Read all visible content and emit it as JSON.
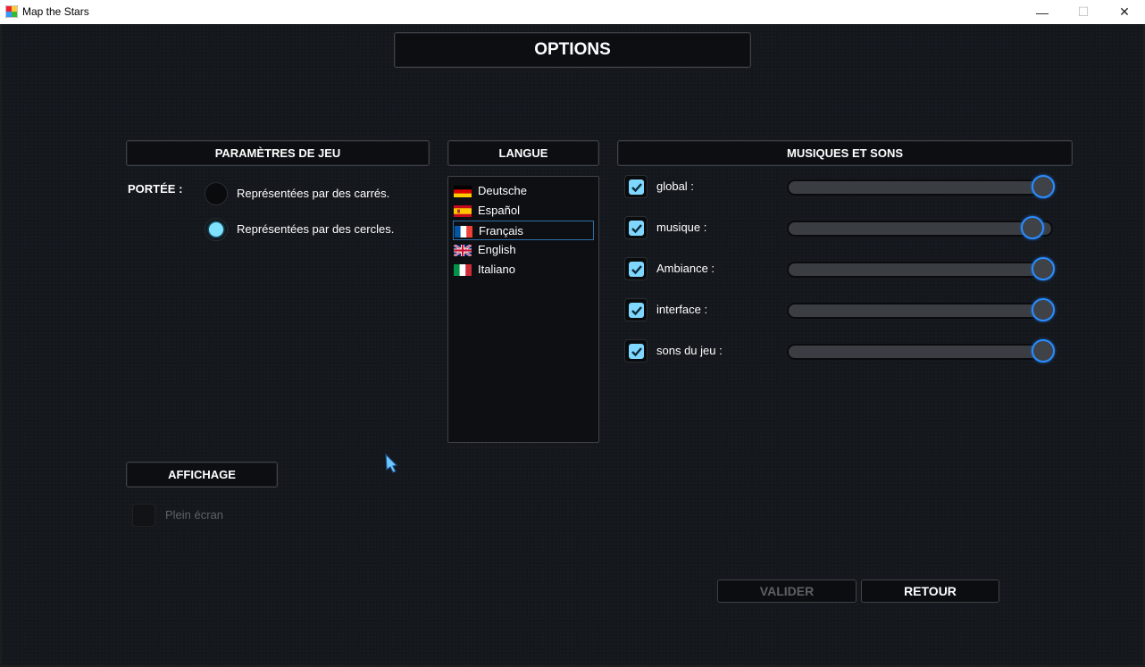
{
  "window": {
    "title": "Map the Stars",
    "minimize": "—",
    "maximize": "☐",
    "close": "✕"
  },
  "page": {
    "title": "OPTIONS"
  },
  "game_settings": {
    "header": "PARAMÈTRES DE JEU",
    "range_label": "PORTÉE :",
    "options": [
      {
        "label": "Représentées par des carrés.",
        "selected": false
      },
      {
        "label": "Représentées par des cercles.",
        "selected": true
      }
    ]
  },
  "language": {
    "header": "LANGUE",
    "items": [
      {
        "label": "Deutsche",
        "flag": "germany-flag-icon",
        "selected": false
      },
      {
        "label": "Español",
        "flag": "spain-flag-icon",
        "selected": false
      },
      {
        "label": "Français",
        "flag": "france-flag-icon",
        "selected": true
      },
      {
        "label": "English",
        "flag": "uk-flag-icon",
        "selected": false
      },
      {
        "label": "Italiano",
        "flag": "italy-flag-icon",
        "selected": false
      }
    ]
  },
  "audio": {
    "header": "MUSIQUES ET SONS",
    "channels": [
      {
        "label": "global :",
        "enabled": true,
        "level": 1.0
      },
      {
        "label": "musique :",
        "enabled": true,
        "level": 0.95
      },
      {
        "label": "Ambiance :",
        "enabled": true,
        "level": 1.0
      },
      {
        "label": "interface :",
        "enabled": true,
        "level": 1.0
      },
      {
        "label": "sons du jeu :",
        "enabled": true,
        "level": 1.0
      }
    ]
  },
  "display": {
    "header": "AFFICHAGE",
    "fullscreen_label": "Plein écran",
    "fullscreen": false
  },
  "buttons": {
    "validate": "VALIDER",
    "back": "RETOUR"
  },
  "colors": {
    "accent": "#7fd7ff",
    "slider_ring": "#2a8cff",
    "background": "#14171c"
  }
}
